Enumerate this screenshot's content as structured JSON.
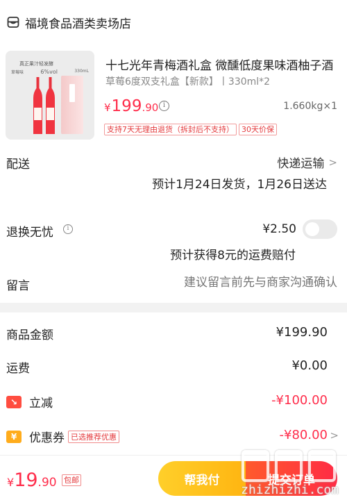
{
  "shop": {
    "name": "福境食品酒类卖场店",
    "icon": "store-icon"
  },
  "product": {
    "title": "十七光年青梅酒礼盒 微醺低度果味酒柚子酒",
    "spec": "草莓6度双支礼盒【新款】丨330ml*2",
    "price_symbol": "¥",
    "price_int": "199",
    "price_dec": ".90",
    "weight_qty": "1.660kg×1",
    "tags": [
      "支持7天无理由退货（拆封后不支持）",
      "30天价保"
    ],
    "image": {
      "title": "真正果汁轻发酵",
      "labels": [
        "草莓味",
        "6%vol",
        "330mL"
      ]
    }
  },
  "delivery": {
    "label": "配送",
    "method": "快递运输",
    "estimate": "预计1月24日发货，1月26日送达"
  },
  "return_insurance": {
    "label": "退换无忧",
    "price": "¥2.50",
    "note": "预计获得8元的运费赔付",
    "enabled": false
  },
  "message": {
    "label": "留言",
    "placeholder": "建议留言前先与商家沟通确认"
  },
  "summary": {
    "goods_label": "商品金额",
    "goods_value": "¥199.90",
    "freight_label": "运费",
    "freight_value": "¥0.00",
    "discount_label": "立减",
    "discount_value": "-¥100.00",
    "coupon_label": "优惠券",
    "coupon_tag": "已选推荐优惠",
    "coupon_value": "-¥80.00"
  },
  "footer": {
    "total_symbol": "¥",
    "total_int": "19",
    "total_dec": ".90",
    "ship_free": "包邮",
    "help_label": "帮我付",
    "submit_label": "提交订单"
  },
  "watermark": {
    "text": "zhizhizhi.com"
  },
  "colors": {
    "accent_red": "#ff2d4b",
    "help_yellow": "#ffb511",
    "submit_red": "#ff2b45"
  }
}
